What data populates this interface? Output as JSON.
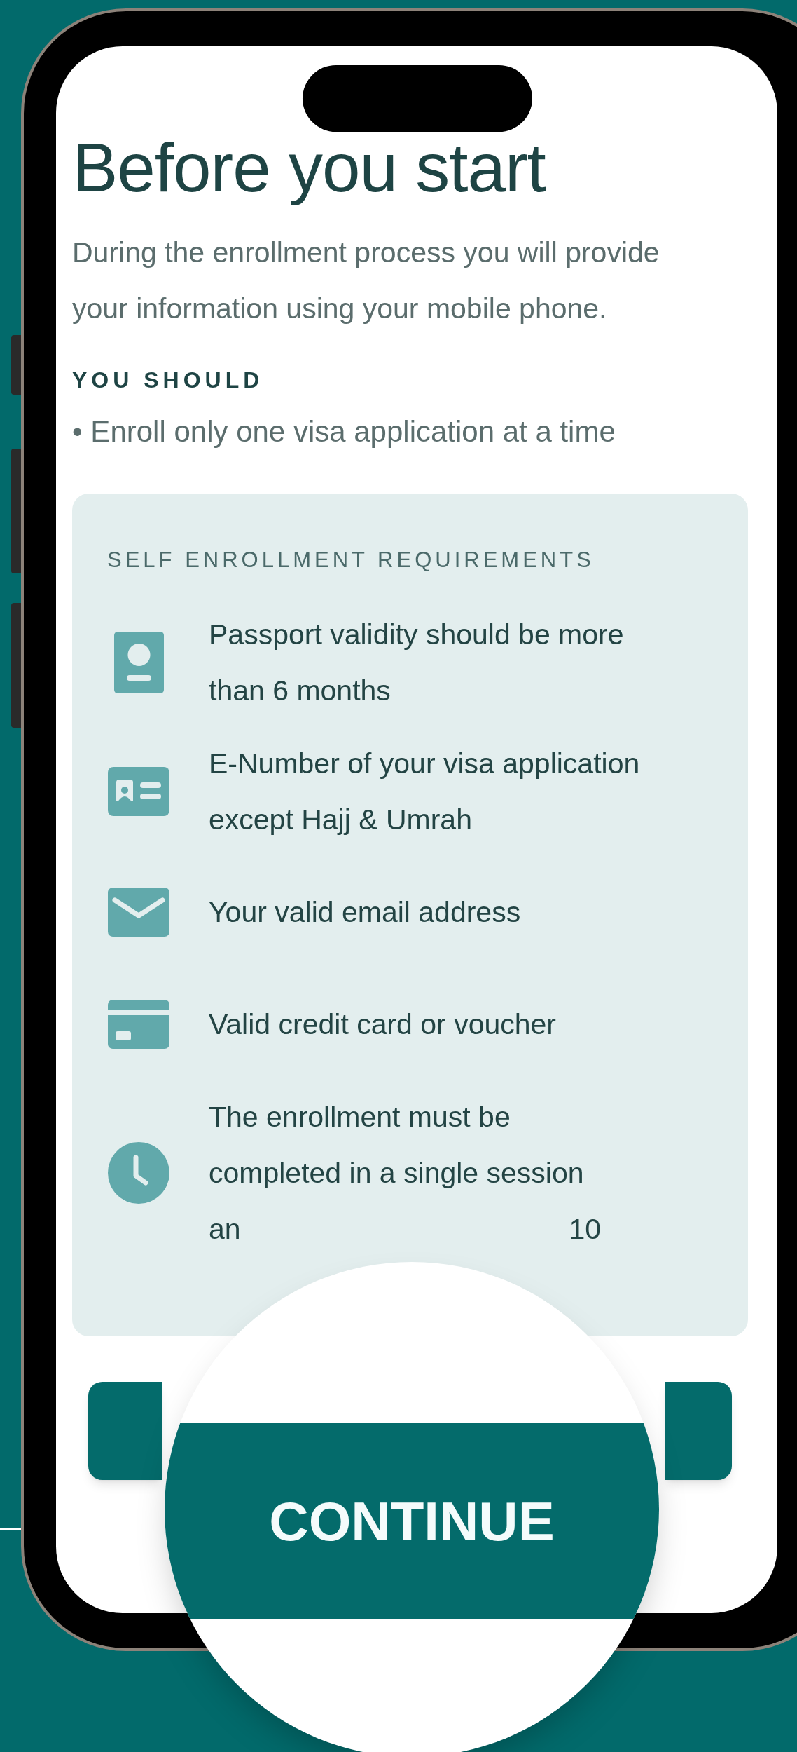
{
  "screen": {
    "title": "Before you start",
    "intro": "During the enrollment process you will provide your information using your mobile phone.",
    "you_should": {
      "heading": "YOU SHOULD",
      "items": [
        "• Enroll only one visa application at a time"
      ]
    },
    "requirements": {
      "heading": "SELF ENROLLMENT REQUIREMENTS",
      "items": [
        {
          "kind": "passport",
          "text": "Passport validity should be more than 6 months"
        },
        {
          "kind": "id-card",
          "text": "E-Number of your visa application except Hajj & Umrah"
        },
        {
          "kind": "email",
          "text": "Your valid email address"
        },
        {
          "kind": "credit-card",
          "text": "Valid credit card or voucher"
        },
        {
          "kind": "clock",
          "text": "The enrollment must be completed in a single session",
          "fragments": [
            "an",
            "10"
          ]
        }
      ]
    },
    "continue_button": {
      "label": "CONTINUE"
    }
  }
}
